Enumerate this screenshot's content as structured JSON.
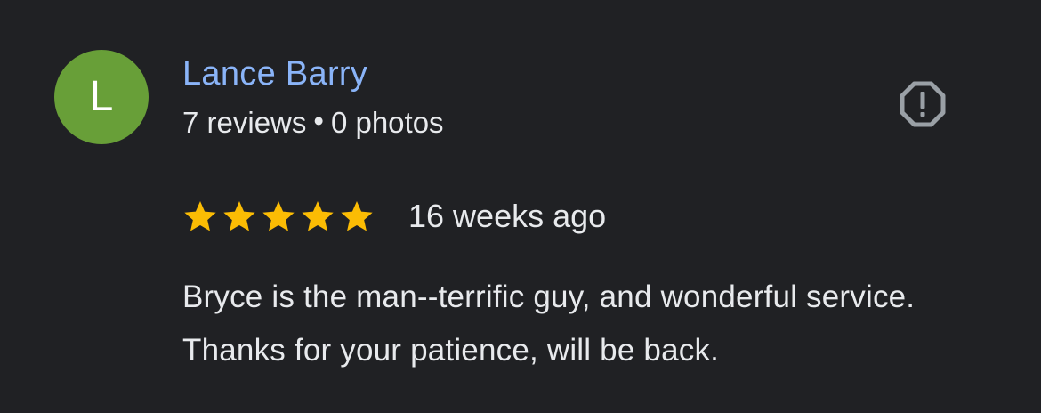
{
  "reviewer": {
    "initial": "L",
    "avatar_color": "#689f38",
    "name": "Lance Barry",
    "reviews_count": "7 reviews",
    "separator": "•",
    "photos_count": "0 photos",
    "name_color": "#8ab4f8"
  },
  "report": {
    "icon": "report-flag-octagon-icon",
    "color": "#9aa0a6"
  },
  "rating": {
    "stars": 5,
    "max": 5,
    "star_color": "#fbbc04",
    "time_ago": "16 weeks ago"
  },
  "review": {
    "text": "Bryce is the man--terrific guy, and wonderful service. Thanks for your patience, will be back."
  },
  "theme": {
    "background": "#202124",
    "text": "#e8eaed"
  }
}
